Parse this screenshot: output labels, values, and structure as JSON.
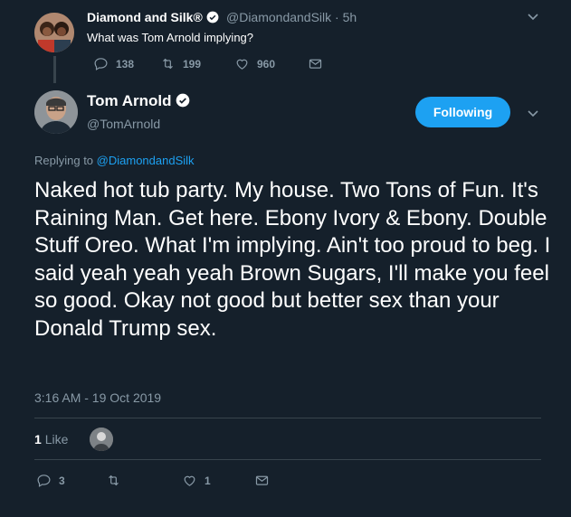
{
  "parent_tweet": {
    "display_name": "Diamond and Silk®",
    "handle": "@DiamondandSilk",
    "separator": "·",
    "time": "5h",
    "text": "What was Tom Arnold implying?",
    "replies": "138",
    "retweets": "199",
    "likes": "960"
  },
  "main_tweet": {
    "display_name": "Tom Arnold",
    "handle": "@TomArnold",
    "follow_label": "Following",
    "replying_prefix": "Replying to",
    "replying_to": "@DiamondandSilk",
    "text": "Naked hot tub party. My house. Two Tons of Fun. It's Raining Man. Get here. Ebony Ivory & Ebony. Double Stuff Oreo. What I'm implying. Ain't too proud to beg. I said yeah yeah yeah Brown Sugars, I'll make you feel so good. Okay not good but better sex than your Donald Trump sex.",
    "timestamp": "3:16 AM - 19 Oct 2019",
    "like_count": "1",
    "like_label": "Like",
    "replies": "3",
    "likes": "1"
  },
  "colors": {
    "background": "#15202b",
    "accent": "#1da1f2",
    "muted": "#8899a6",
    "divider": "#38444d"
  },
  "icons": [
    "verified-icon",
    "reply-icon",
    "retweet-icon",
    "like-icon",
    "message-icon",
    "chevron-down-icon"
  ]
}
